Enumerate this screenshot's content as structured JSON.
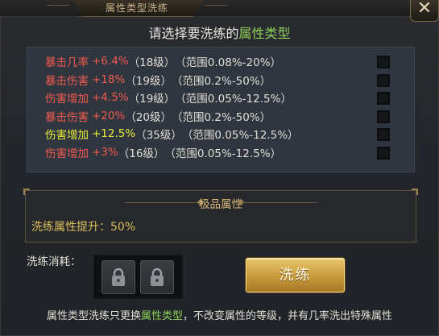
{
  "window": {
    "title": "属性类型洗练",
    "close_label": "✕"
  },
  "heading": {
    "prefix": "请选择要洗练的",
    "highlight": "属性类型"
  },
  "attributes": [
    {
      "name": "暴击几率",
      "value": "+6.4%",
      "level": "（18级）",
      "range": "（范围0.08%-20%）",
      "color": "#f05a4e",
      "checked": false
    },
    {
      "name": "暴击伤害",
      "value": "+18%",
      "level": "（19级）",
      "range": "（范围0.2%-50%）",
      "color": "#f05a4e",
      "checked": false
    },
    {
      "name": "伤害增加",
      "value": "+4.5%",
      "level": "（19级）",
      "range": "（范围0.05%-12.5%）",
      "color": "#f05a4e",
      "checked": false
    },
    {
      "name": "暴击伤害",
      "value": "+20%",
      "level": "（20级）",
      "range": "（范围0.2%-50%）",
      "color": "#f05a4e",
      "checked": false
    },
    {
      "name": "伤害增加",
      "value": "+12.5%",
      "level": "（35级）",
      "range": "（范围0.05%-12.5%）",
      "color": "#e8ec3a",
      "checked": false
    },
    {
      "name": "伤害增加",
      "value": "+3%",
      "level": "（16级）",
      "range": "（范围0.05%-12.5%）",
      "color": "#f05a4e",
      "checked": false
    }
  ],
  "quality": {
    "title": "极品属性",
    "text": "洗练属性提升：50%"
  },
  "cost": {
    "label": "洗练消耗：",
    "slots": [
      {
        "icon": "lock-icon"
      },
      {
        "icon": "lock-icon"
      }
    ]
  },
  "wash_button": "洗练",
  "footer": {
    "part1": "属性类型洗练只更换",
    "highlight": "属性类型",
    "part2": "，不改变属性的等级，并有几率洗出特殊属性"
  }
}
